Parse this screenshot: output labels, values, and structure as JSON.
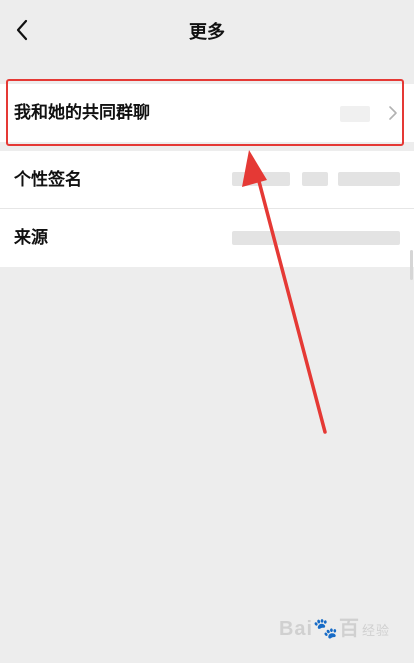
{
  "header": {
    "title": "更多"
  },
  "rows": [
    {
      "label": "我和她的共同群聊"
    },
    {
      "label": "个性签名"
    },
    {
      "label": "来源"
    }
  ],
  "watermark": {
    "brand": "Bai",
    "brand2": "百",
    "sub": "经验"
  }
}
